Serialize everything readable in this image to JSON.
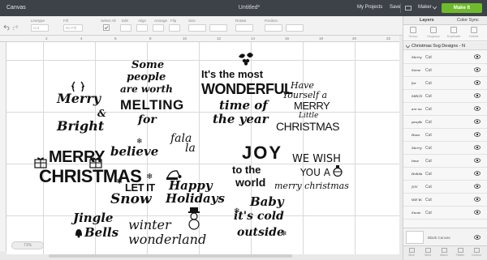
{
  "topbar": {
    "app_title": "Canvas",
    "doc_title": "Untitled*",
    "my_projects": "My Projects",
    "save": "Save",
    "machine": "Maker",
    "make_it": "Make It"
  },
  "toolbar": {
    "undo_icon": "undo-icon",
    "redo_icon": "redo-icon",
    "linetype_label": "Linetype",
    "linetype_value": "Cut",
    "fill_label": "Fill",
    "fill_value": "No Fill",
    "select_all_label": "Select All",
    "edit_label": "Edit",
    "align_label": "Align",
    "arrange_label": "Arrange",
    "flip_label": "Flip",
    "size_label": "Size",
    "rotate_label": "Rotate",
    "position_label": "Position"
  },
  "ruler": {
    "marks": [
      "2",
      "4",
      "6",
      "8",
      "10",
      "12",
      "14",
      "16",
      "18",
      "20",
      "22"
    ]
  },
  "canvas": {
    "zoom": "71%",
    "designs": {
      "merry_bright_a": "Merry",
      "merry_bright_b": "&",
      "merry_bright_c": "Bright",
      "some_people_a": "Some",
      "some_people_b": "people",
      "some_people_c": "are worth",
      "some_people_d": "MELTING",
      "some_people_e": "for",
      "wonderful_a": "It's the most",
      "wonderful_b": "WONDERFUL",
      "wonderful_c": "time of",
      "wonderful_d": "the year",
      "have_yourself_a": "Have",
      "have_yourself_b": "Yourself a",
      "have_yourself_c": "MERRY",
      "have_yourself_d": "Little",
      "have_yourself_e": "CHRISTMAS",
      "fala_la_a": "fala",
      "fala_la_b": "la",
      "believe": "believe",
      "joy_a": "JOY",
      "joy_b": "to the",
      "joy_c": "world",
      "merry_christmas_a": "MERRY",
      "merry_christmas_b": "CHRISTMAS",
      "we_wish_a": "WE WISH",
      "we_wish_b": "YOU A",
      "we_wish_c": "merry christmas",
      "let_it_snow_a": "LET IT",
      "let_it_snow_b": "Snow",
      "happy_holidays_a": "Happy",
      "happy_holidays_b": "Holidays",
      "jingle_bells_a": "Jingle",
      "jingle_bells_b": "Bells",
      "winter_wonderland_a": "winter",
      "winter_wonderland_b": "wonderland",
      "baby_cold_a": "Baby",
      "baby_cold_b": "it's cold",
      "baby_cold_c": "outside"
    }
  },
  "panel": {
    "tab_layers": "Layers",
    "tab_color_sync": "Color Sync",
    "tools": [
      "Group",
      "Ungroup",
      "Duplicate",
      "Delete"
    ],
    "group_name": "Christmas Svg Designs - N",
    "layers": [
      {
        "thumb": "Merry",
        "op": "Cut"
      },
      {
        "thumb": "Some",
        "op": "Cut"
      },
      {
        "thumb": "for",
        "op": "Cut"
      },
      {
        "thumb": "MELTING",
        "op": "Cut"
      },
      {
        "thumb": "are worth",
        "op": "Cut"
      },
      {
        "thumb": "people",
        "op": "Cut"
      },
      {
        "thumb": "Have",
        "op": "Cut"
      },
      {
        "thumb": "Merry",
        "op": "Cut"
      },
      {
        "thumb": "time",
        "op": "Cut"
      },
      {
        "thumb": "Holidays",
        "op": "Cut"
      },
      {
        "thumb": "JOY",
        "op": "Cut"
      },
      {
        "thumb": "WE WISH",
        "op": "Cut"
      },
      {
        "thumb": "Snow",
        "op": "Cut"
      }
    ],
    "blank_canvas": "Blank Canvas",
    "footer": [
      "Slice",
      "Weld",
      "Attach",
      "Flatten",
      "Contour"
    ]
  },
  "colors": {
    "topbar": "#3d4248",
    "make_it": "#6fba2c",
    "canvas": "#ffffff",
    "grid": "#d9d9d9"
  }
}
